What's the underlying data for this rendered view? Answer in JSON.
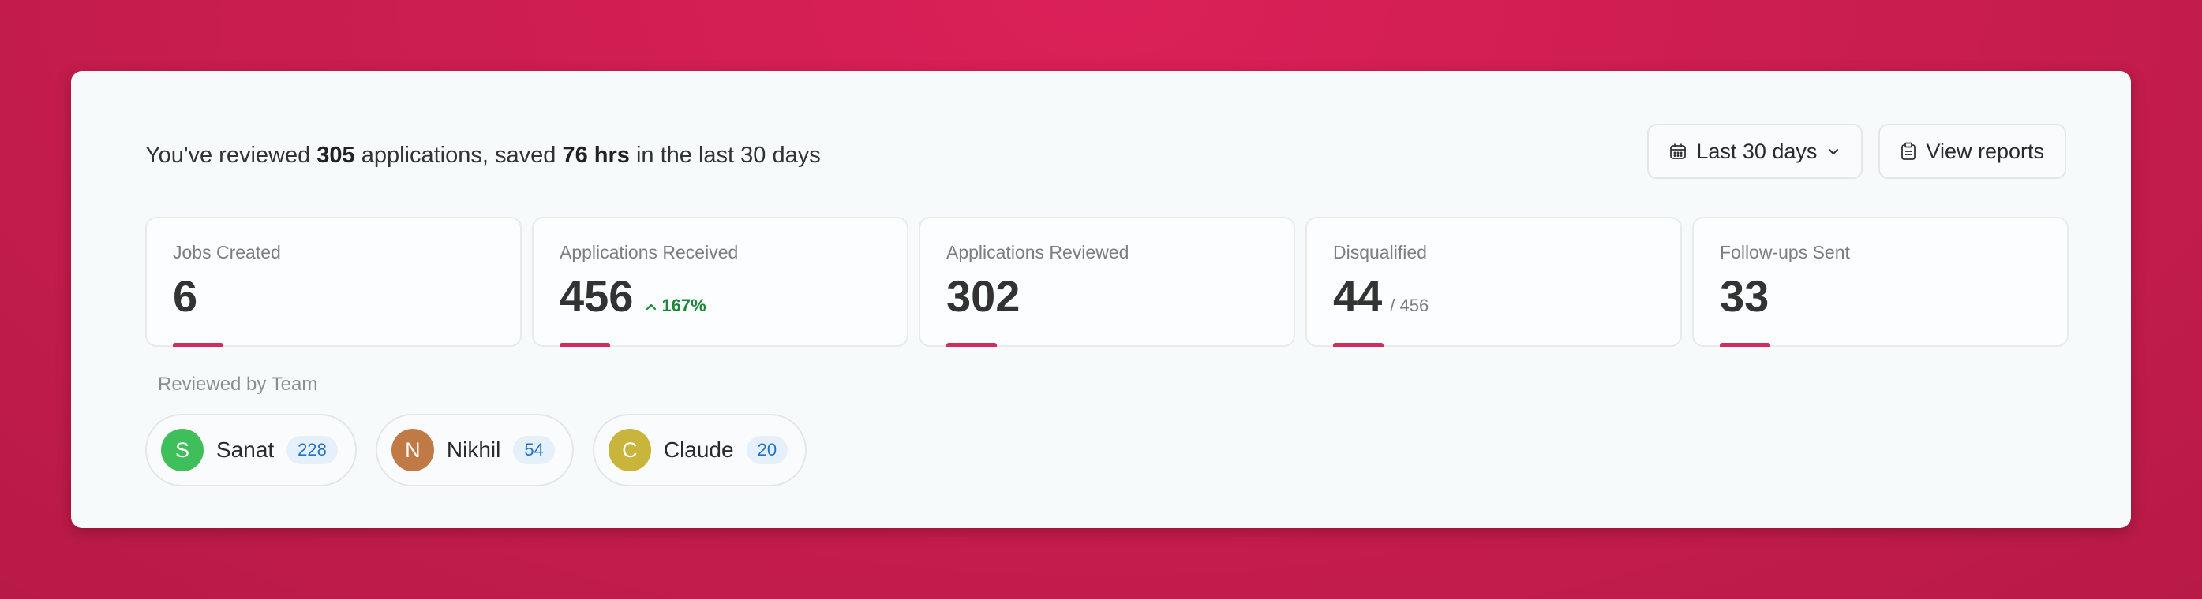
{
  "summary": {
    "prefix": "You've reviewed ",
    "reviewed_count": "305",
    "middle": " applications, saved ",
    "saved_hours": "76 hrs",
    "suffix": " in the last 30 days"
  },
  "actions": {
    "date_range_label": "Last 30 days",
    "view_reports_label": "View reports"
  },
  "stats": [
    {
      "label": "Jobs Created",
      "value": "6"
    },
    {
      "label": "Applications Received",
      "value": "456",
      "trend": "167%"
    },
    {
      "label": "Applications Reviewed",
      "value": "302"
    },
    {
      "label": "Disqualified",
      "value": "44",
      "sub": "/ 456"
    },
    {
      "label": "Follow-ups Sent",
      "value": "33"
    }
  ],
  "team": {
    "label": "Reviewed by Team",
    "members": [
      {
        "initial": "S",
        "name": "Sanat",
        "count": "228",
        "color": "#3fbf5a"
      },
      {
        "initial": "N",
        "name": "Nikhil",
        "count": "54",
        "color": "#c07a45"
      },
      {
        "initial": "C",
        "name": "Claude",
        "count": "20",
        "color": "#c9b43c"
      }
    ]
  },
  "colors": {
    "accent": "#d42a5c",
    "trend_up": "#1a8a3a",
    "count_text": "#1e73c8"
  },
  "icons": {
    "calendar": "calendar-icon",
    "chevron": "chevron-down-icon",
    "clipboard": "clipboard-icon",
    "trend": "trend-up-icon"
  }
}
